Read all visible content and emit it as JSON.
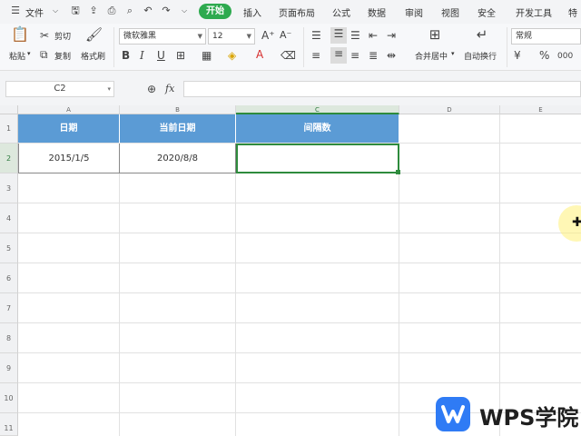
{
  "menu": {
    "file": "文件",
    "tabs": [
      "开始",
      "插入",
      "页面布局",
      "公式",
      "数据",
      "审阅",
      "视图",
      "安全",
      "开发工具",
      "特"
    ]
  },
  "ribbon": {
    "paste": "粘贴",
    "cut": "剪切",
    "copy": "复制",
    "format_painter": "格式刷",
    "font_name": "微软雅黑",
    "font_size": "12",
    "merge_center": "合并居中",
    "wrap_text": "自动换行",
    "number_format": "常规",
    "bold": "B",
    "italic": "I",
    "underline": "U",
    "percent": "%",
    "thousands": "000",
    "font_color_letter": "A"
  },
  "formula_bar": {
    "name_box": "C2",
    "fx": "fx",
    "value": ""
  },
  "sheet": {
    "columns": [
      "A",
      "B",
      "C",
      "D",
      "E"
    ],
    "rows": [
      "1",
      "2",
      "3",
      "4",
      "5",
      "6",
      "7",
      "8",
      "9",
      "10",
      "11"
    ],
    "headers": [
      "日期",
      "当前日期",
      "间隔数"
    ],
    "row2": [
      "2015/1/5",
      "2020/8/8",
      ""
    ]
  },
  "watermark": {
    "text": "WPS学院"
  },
  "colors": {
    "accent_green": "#2eaa4f",
    "header_blue": "#5b9bd5",
    "selection_green": "#2e8b3d",
    "wps_blue": "#2f7bf5"
  }
}
